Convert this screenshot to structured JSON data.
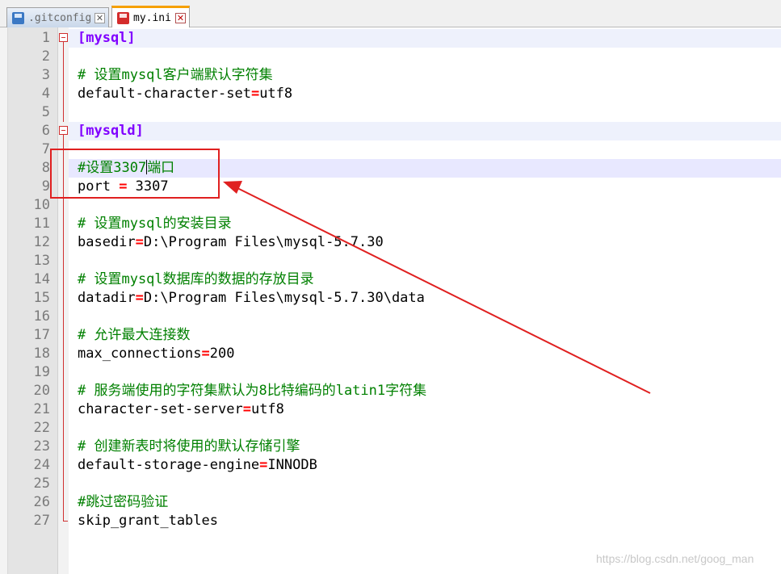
{
  "tabs": [
    {
      "label": ".gitconfig",
      "icon": "saved-file-icon",
      "active": false
    },
    {
      "label": "my.ini",
      "icon": "unsaved-file-icon",
      "active": true
    }
  ],
  "close_glyph": "✕",
  "colors": {
    "section": "#8000ff",
    "comment": "#008000",
    "operator": "#ff0000",
    "annotation": "#e02020",
    "gutter_bg": "#e4e4e4"
  },
  "lines": [
    {
      "n": "1",
      "parts": [
        {
          "t": "section",
          "v": "[mysql]"
        }
      ],
      "fold": "start",
      "bg": "section"
    },
    {
      "n": "2",
      "parts": [],
      "fold": "line"
    },
    {
      "n": "3",
      "parts": [
        {
          "t": "comment",
          "v": "# 设置mysql客户端默认字符集"
        }
      ],
      "fold": "line"
    },
    {
      "n": "4",
      "parts": [
        {
          "t": "text",
          "v": "default-character-set"
        },
        {
          "t": "eq",
          "v": "="
        },
        {
          "t": "text",
          "v": "utf8"
        }
      ],
      "fold": "line"
    },
    {
      "n": "5",
      "parts": [],
      "fold": "line"
    },
    {
      "n": "6",
      "parts": [
        {
          "t": "section",
          "v": "[mysqld]"
        }
      ],
      "fold": "start",
      "bg": "section"
    },
    {
      "n": "7",
      "parts": [],
      "fold": "line"
    },
    {
      "n": "8",
      "parts": [
        {
          "t": "comment",
          "v": "#设置3307"
        },
        {
          "t": "caret",
          "v": ""
        },
        {
          "t": "comment",
          "v": "端口"
        }
      ],
      "fold": "line",
      "bg": "caret"
    },
    {
      "n": "9",
      "parts": [
        {
          "t": "text",
          "v": "port "
        },
        {
          "t": "eq",
          "v": "="
        },
        {
          "t": "text",
          "v": " 3307"
        }
      ],
      "fold": "line"
    },
    {
      "n": "10",
      "parts": [],
      "fold": "line"
    },
    {
      "n": "11",
      "parts": [
        {
          "t": "comment",
          "v": "# 设置mysql的安装目录"
        }
      ],
      "fold": "line"
    },
    {
      "n": "12",
      "parts": [
        {
          "t": "text",
          "v": "basedir"
        },
        {
          "t": "eq",
          "v": "="
        },
        {
          "t": "text",
          "v": "D:\\Program Files\\mysql-5.7.30"
        }
      ],
      "fold": "line"
    },
    {
      "n": "13",
      "parts": [],
      "fold": "line"
    },
    {
      "n": "14",
      "parts": [
        {
          "t": "comment",
          "v": "# 设置mysql数据库的数据的存放目录"
        }
      ],
      "fold": "line"
    },
    {
      "n": "15",
      "parts": [
        {
          "t": "text",
          "v": "datadir"
        },
        {
          "t": "eq",
          "v": "="
        },
        {
          "t": "text",
          "v": "D:\\Program Files\\mysql-5.7.30\\data"
        }
      ],
      "fold": "line"
    },
    {
      "n": "16",
      "parts": [],
      "fold": "line"
    },
    {
      "n": "17",
      "parts": [
        {
          "t": "comment",
          "v": "# 允许最大连接数"
        }
      ],
      "fold": "line"
    },
    {
      "n": "18",
      "parts": [
        {
          "t": "text",
          "v": "max_connections"
        },
        {
          "t": "eq",
          "v": "="
        },
        {
          "t": "text",
          "v": "200"
        }
      ],
      "fold": "line"
    },
    {
      "n": "19",
      "parts": [],
      "fold": "line"
    },
    {
      "n": "20",
      "parts": [
        {
          "t": "comment",
          "v": "# 服务端使用的字符集默认为8比特编码的latin1字符集"
        }
      ],
      "fold": "line"
    },
    {
      "n": "21",
      "parts": [
        {
          "t": "text",
          "v": "character-set-server"
        },
        {
          "t": "eq",
          "v": "="
        },
        {
          "t": "text",
          "v": "utf8"
        }
      ],
      "fold": "line"
    },
    {
      "n": "22",
      "parts": [],
      "fold": "line"
    },
    {
      "n": "23",
      "parts": [
        {
          "t": "comment",
          "v": "# 创建新表时将使用的默认存储引擎"
        }
      ],
      "fold": "line"
    },
    {
      "n": "24",
      "parts": [
        {
          "t": "text",
          "v": "default-storage-engine"
        },
        {
          "t": "eq",
          "v": "="
        },
        {
          "t": "text",
          "v": "INNODB"
        }
      ],
      "fold": "line"
    },
    {
      "n": "25",
      "parts": [],
      "fold": "line"
    },
    {
      "n": "26",
      "parts": [
        {
          "t": "comment",
          "v": "#跳过密码验证"
        }
      ],
      "fold": "line"
    },
    {
      "n": "27",
      "parts": [
        {
          "t": "text",
          "v": "skip_grant_tables"
        }
      ],
      "fold": "end"
    }
  ],
  "watermark": "https://blog.csdn.net/goog_man"
}
